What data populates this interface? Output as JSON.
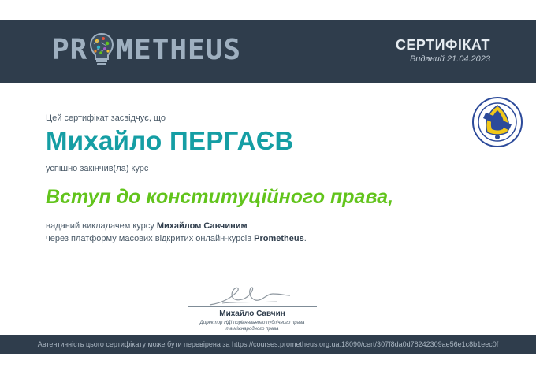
{
  "header": {
    "logo_text_left": "PR",
    "logo_text_right": "METHEUS",
    "certificate_title": "СЕРТИФІКАТ",
    "issued": "Виданий 21.04.2023"
  },
  "body": {
    "intro": "Цей сертифікат засвідчує, що",
    "recipient_name": "Михайло ПЕРГАЄВ",
    "completed": "успішно закінчив(ла) курс",
    "course_title": "Вступ до конституційного права,",
    "taught_prefix": "наданий викладачем курсу ",
    "instructor": "Михайлом Савчиним",
    "platform_prefix": "через платформу масових відкритих онлайн-курсів ",
    "platform_name": "Prometheus",
    "platform_suffix": "."
  },
  "signature": {
    "name": "Михайло Савчин",
    "role_line1": "Директор НДІ порівняльного публічного права",
    "role_line2": "та міжнародного права"
  },
  "footer": {
    "authenticity": "Автентичність цього сертифікату може бути перевірена за https://courses.prometheus.org.ua:18090/cert/307f8da0d78242309ae56e1c8b1eec0f"
  },
  "colors": {
    "header_bg": "#2f3d4c",
    "name_color": "#159ea4",
    "course_color": "#62c41c"
  },
  "icons": {
    "logo_bulb": "lightbulb-icon",
    "seal": "university-seal-icon"
  }
}
